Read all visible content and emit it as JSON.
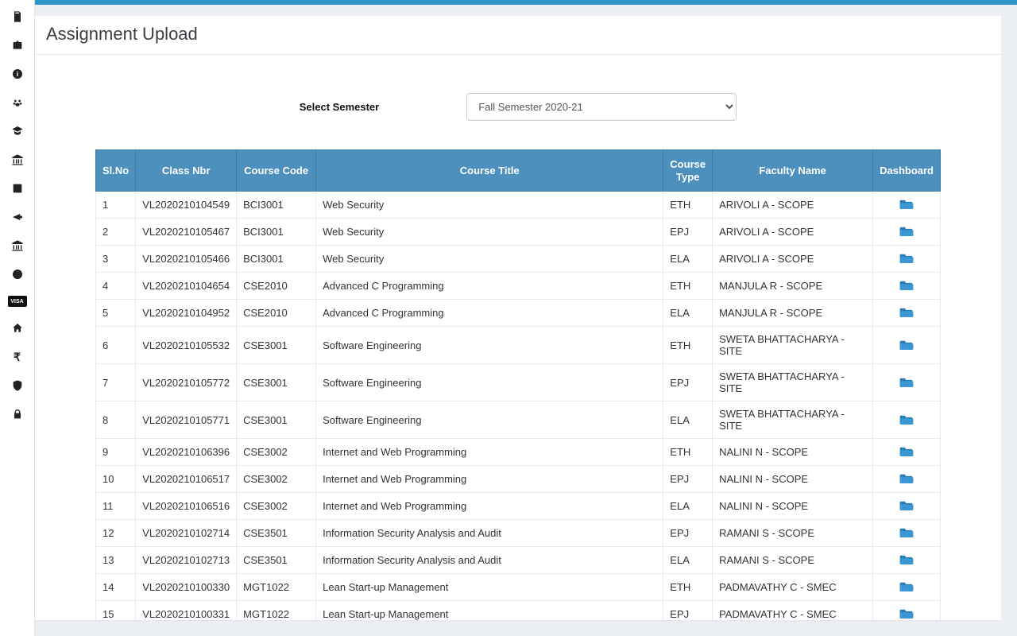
{
  "page": {
    "title": "Assignment Upload"
  },
  "selector": {
    "label": "Select Semester",
    "value": "Fall Semester 2020-21",
    "options": [
      "Fall Semester 2020-21"
    ]
  },
  "table": {
    "headers": {
      "slno": "Sl.No",
      "classnbr": "Class Nbr",
      "coursecode": "Course Code",
      "coursetitle": "Course Title",
      "coursetype": "Course Type",
      "faculty": "Faculty Name",
      "dashboard": "Dashboard"
    },
    "rows": [
      {
        "sl": "1",
        "nbr": "VL2020210104549",
        "code": "BCI3001",
        "title": "Web Security",
        "type": "ETH",
        "fac": "ARIVOLI A - SCOPE"
      },
      {
        "sl": "2",
        "nbr": "VL2020210105467",
        "code": "BCI3001",
        "title": "Web Security",
        "type": "EPJ",
        "fac": "ARIVOLI A - SCOPE"
      },
      {
        "sl": "3",
        "nbr": "VL2020210105466",
        "code": "BCI3001",
        "title": "Web Security",
        "type": "ELA",
        "fac": "ARIVOLI A - SCOPE"
      },
      {
        "sl": "4",
        "nbr": "VL2020210104654",
        "code": "CSE2010",
        "title": "Advanced C Programming",
        "type": "ETH",
        "fac": "MANJULA R - SCOPE"
      },
      {
        "sl": "5",
        "nbr": "VL2020210104952",
        "code": "CSE2010",
        "title": "Advanced C Programming",
        "type": "ELA",
        "fac": "MANJULA R - SCOPE"
      },
      {
        "sl": "6",
        "nbr": "VL2020210105532",
        "code": "CSE3001",
        "title": "Software Engineering",
        "type": "ETH",
        "fac": "SWETA BHATTACHARYA - SITE"
      },
      {
        "sl": "7",
        "nbr": "VL2020210105772",
        "code": "CSE3001",
        "title": "Software Engineering",
        "type": "EPJ",
        "fac": "SWETA BHATTACHARYA - SITE"
      },
      {
        "sl": "8",
        "nbr": "VL2020210105771",
        "code": "CSE3001",
        "title": "Software Engineering",
        "type": "ELA",
        "fac": "SWETA BHATTACHARYA - SITE"
      },
      {
        "sl": "9",
        "nbr": "VL2020210106396",
        "code": "CSE3002",
        "title": "Internet and Web Programming",
        "type": "ETH",
        "fac": "NALINI N - SCOPE"
      },
      {
        "sl": "10",
        "nbr": "VL2020210106517",
        "code": "CSE3002",
        "title": "Internet and Web Programming",
        "type": "EPJ",
        "fac": "NALINI N - SCOPE"
      },
      {
        "sl": "11",
        "nbr": "VL2020210106516",
        "code": "CSE3002",
        "title": "Internet and Web Programming",
        "type": "ELA",
        "fac": "NALINI N - SCOPE"
      },
      {
        "sl": "12",
        "nbr": "VL2020210102714",
        "code": "CSE3501",
        "title": "Information Security Analysis and Audit",
        "type": "EPJ",
        "fac": "RAMANI S - SCOPE"
      },
      {
        "sl": "13",
        "nbr": "VL2020210102713",
        "code": "CSE3501",
        "title": "Information Security Analysis and Audit",
        "type": "ELA",
        "fac": "RAMANI S - SCOPE"
      },
      {
        "sl": "14",
        "nbr": "VL2020210100330",
        "code": "MGT1022",
        "title": "Lean Start-up Management",
        "type": "ETH",
        "fac": "PADMAVATHY C - SMEC"
      },
      {
        "sl": "15",
        "nbr": "VL2020210100331",
        "code": "MGT1022",
        "title": "Lean Start-up Management",
        "type": "EPJ",
        "fac": "PADMAVATHY C - SMEC"
      }
    ]
  },
  "sidebar": {
    "items": [
      {
        "name": "phone-icon"
      },
      {
        "name": "briefcase-icon"
      },
      {
        "name": "info-icon"
      },
      {
        "name": "paw-icon"
      },
      {
        "name": "grad-cap-icon"
      },
      {
        "name": "institution-icon"
      },
      {
        "name": "book-icon"
      },
      {
        "name": "arrow-icon"
      },
      {
        "name": "institution-icon-2"
      },
      {
        "name": "globe-icon"
      },
      {
        "name": "visa-badge",
        "label": "VISA"
      },
      {
        "name": "home-icon"
      },
      {
        "name": "rupee-icon",
        "label": "₹"
      },
      {
        "name": "shield-icon"
      },
      {
        "name": "lock-icon"
      }
    ]
  }
}
